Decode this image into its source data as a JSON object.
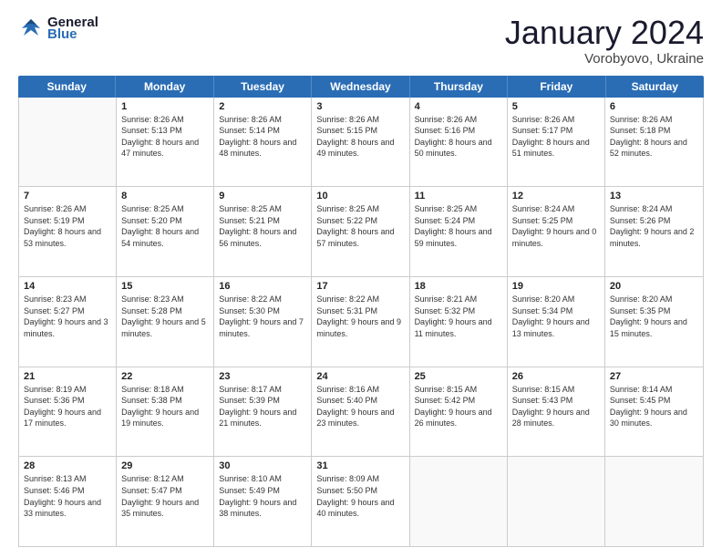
{
  "header": {
    "logo_general": "General",
    "logo_blue": "Blue",
    "month_title": "January 2024",
    "location": "Vorobyovo, Ukraine"
  },
  "calendar": {
    "days_of_week": [
      "Sunday",
      "Monday",
      "Tuesday",
      "Wednesday",
      "Thursday",
      "Friday",
      "Saturday"
    ],
    "weeks": [
      [
        {
          "day": "",
          "empty": true
        },
        {
          "day": "1",
          "sunrise": "8:26 AM",
          "sunset": "5:13 PM",
          "daylight": "8 hours and 47 minutes."
        },
        {
          "day": "2",
          "sunrise": "8:26 AM",
          "sunset": "5:14 PM",
          "daylight": "8 hours and 48 minutes."
        },
        {
          "day": "3",
          "sunrise": "8:26 AM",
          "sunset": "5:15 PM",
          "daylight": "8 hours and 49 minutes."
        },
        {
          "day": "4",
          "sunrise": "8:26 AM",
          "sunset": "5:16 PM",
          "daylight": "8 hours and 50 minutes."
        },
        {
          "day": "5",
          "sunrise": "8:26 AM",
          "sunset": "5:17 PM",
          "daylight": "8 hours and 51 minutes."
        },
        {
          "day": "6",
          "sunrise": "8:26 AM",
          "sunset": "5:18 PM",
          "daylight": "8 hours and 52 minutes."
        }
      ],
      [
        {
          "day": "7",
          "sunrise": "8:26 AM",
          "sunset": "5:19 PM",
          "daylight": "8 hours and 53 minutes."
        },
        {
          "day": "8",
          "sunrise": "8:25 AM",
          "sunset": "5:20 PM",
          "daylight": "8 hours and 54 minutes."
        },
        {
          "day": "9",
          "sunrise": "8:25 AM",
          "sunset": "5:21 PM",
          "daylight": "8 hours and 56 minutes."
        },
        {
          "day": "10",
          "sunrise": "8:25 AM",
          "sunset": "5:22 PM",
          "daylight": "8 hours and 57 minutes."
        },
        {
          "day": "11",
          "sunrise": "8:25 AM",
          "sunset": "5:24 PM",
          "daylight": "8 hours and 59 minutes."
        },
        {
          "day": "12",
          "sunrise": "8:24 AM",
          "sunset": "5:25 PM",
          "daylight": "9 hours and 0 minutes."
        },
        {
          "day": "13",
          "sunrise": "8:24 AM",
          "sunset": "5:26 PM",
          "daylight": "9 hours and 2 minutes."
        }
      ],
      [
        {
          "day": "14",
          "sunrise": "8:23 AM",
          "sunset": "5:27 PM",
          "daylight": "9 hours and 3 minutes."
        },
        {
          "day": "15",
          "sunrise": "8:23 AM",
          "sunset": "5:28 PM",
          "daylight": "9 hours and 5 minutes."
        },
        {
          "day": "16",
          "sunrise": "8:22 AM",
          "sunset": "5:30 PM",
          "daylight": "9 hours and 7 minutes."
        },
        {
          "day": "17",
          "sunrise": "8:22 AM",
          "sunset": "5:31 PM",
          "daylight": "9 hours and 9 minutes."
        },
        {
          "day": "18",
          "sunrise": "8:21 AM",
          "sunset": "5:32 PM",
          "daylight": "9 hours and 11 minutes."
        },
        {
          "day": "19",
          "sunrise": "8:20 AM",
          "sunset": "5:34 PM",
          "daylight": "9 hours and 13 minutes."
        },
        {
          "day": "20",
          "sunrise": "8:20 AM",
          "sunset": "5:35 PM",
          "daylight": "9 hours and 15 minutes."
        }
      ],
      [
        {
          "day": "21",
          "sunrise": "8:19 AM",
          "sunset": "5:36 PM",
          "daylight": "9 hours and 17 minutes."
        },
        {
          "day": "22",
          "sunrise": "8:18 AM",
          "sunset": "5:38 PM",
          "daylight": "9 hours and 19 minutes."
        },
        {
          "day": "23",
          "sunrise": "8:17 AM",
          "sunset": "5:39 PM",
          "daylight": "9 hours and 21 minutes."
        },
        {
          "day": "24",
          "sunrise": "8:16 AM",
          "sunset": "5:40 PM",
          "daylight": "9 hours and 23 minutes."
        },
        {
          "day": "25",
          "sunrise": "8:15 AM",
          "sunset": "5:42 PM",
          "daylight": "9 hours and 26 minutes."
        },
        {
          "day": "26",
          "sunrise": "8:15 AM",
          "sunset": "5:43 PM",
          "daylight": "9 hours and 28 minutes."
        },
        {
          "day": "27",
          "sunrise": "8:14 AM",
          "sunset": "5:45 PM",
          "daylight": "9 hours and 30 minutes."
        }
      ],
      [
        {
          "day": "28",
          "sunrise": "8:13 AM",
          "sunset": "5:46 PM",
          "daylight": "9 hours and 33 minutes."
        },
        {
          "day": "29",
          "sunrise": "8:12 AM",
          "sunset": "5:47 PM",
          "daylight": "9 hours and 35 minutes."
        },
        {
          "day": "30",
          "sunrise": "8:10 AM",
          "sunset": "5:49 PM",
          "daylight": "9 hours and 38 minutes."
        },
        {
          "day": "31",
          "sunrise": "8:09 AM",
          "sunset": "5:50 PM",
          "daylight": "9 hours and 40 minutes."
        },
        {
          "day": "",
          "empty": true
        },
        {
          "day": "",
          "empty": true
        },
        {
          "day": "",
          "empty": true
        }
      ]
    ],
    "labels": {
      "sunrise": "Sunrise:",
      "sunset": "Sunset:",
      "daylight": "Daylight hours"
    }
  }
}
